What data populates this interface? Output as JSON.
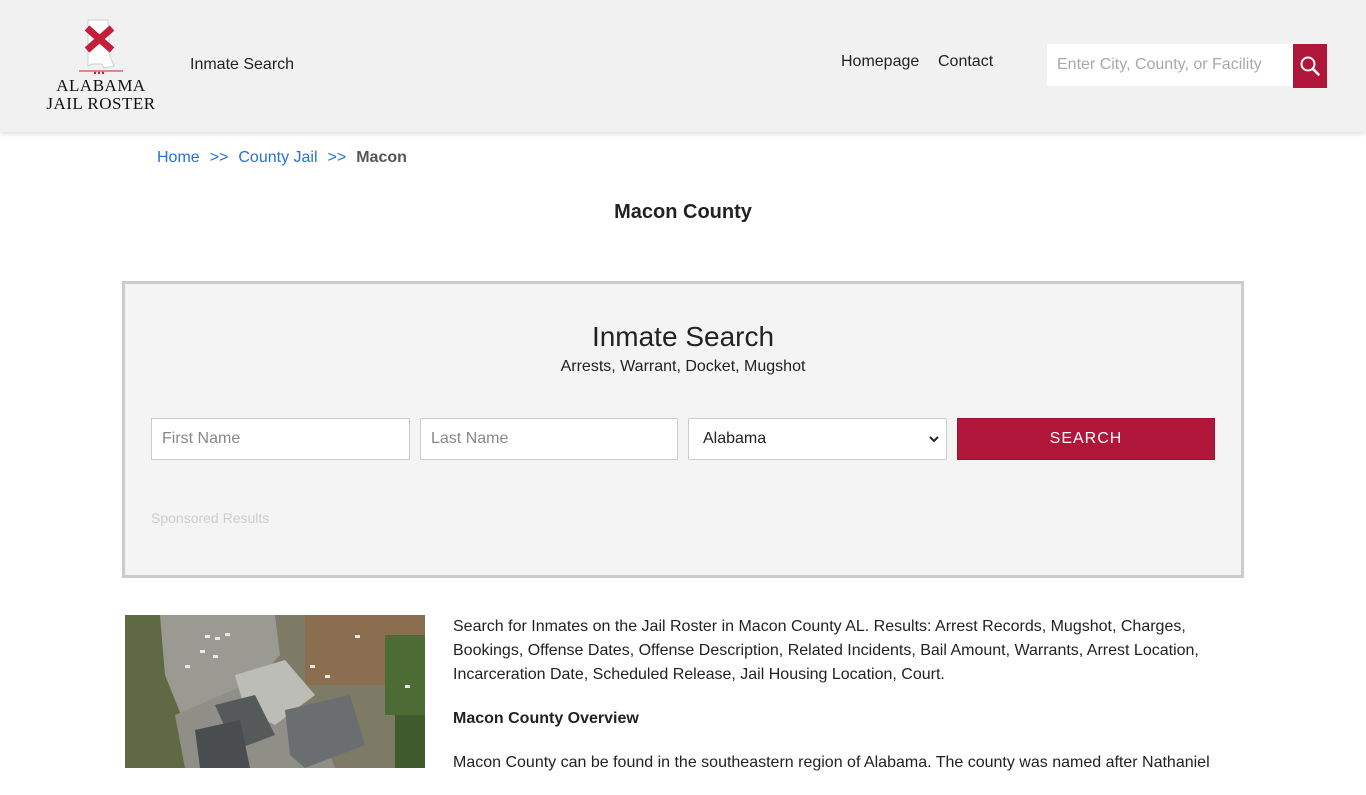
{
  "header": {
    "logo": {
      "line1": "ALABAMA",
      "line2": "JAIL ROSTER"
    },
    "nav_inmate_search": "Inmate Search",
    "nav_homepage": "Homepage",
    "nav_contact": "Contact",
    "search_placeholder": "Enter City, County, or Facility",
    "accent_color": "#b0163a"
  },
  "breadcrumb": {
    "items": [
      "Home",
      "County Jail"
    ],
    "separator": ">>",
    "current": "Macon"
  },
  "page_title": "Macon County",
  "search_panel": {
    "title": "Inmate Search",
    "subtitle": "Arrests, Warrant, Docket, Mugshot",
    "first_name_placeholder": "First Name",
    "last_name_placeholder": "Last Name",
    "state_selected": "Alabama",
    "search_button": "SEARCH",
    "sponsored": "Sponsored Results"
  },
  "content": {
    "intro": "Search for Inmates on the Jail Roster in Macon County AL. Results: Arrest Records, Mugshot, Charges, Bookings, Offense Dates, Offense Description, Related Incidents, Bail Amount, Warrants, Arrest Location, Incarceration Date, Scheduled Release, Jail Housing Location, Court.",
    "overview_heading": "Macon County Overview",
    "overview_text": "Macon County can be found in the southeastern region of Alabama. The county was named after Nathaniel"
  }
}
